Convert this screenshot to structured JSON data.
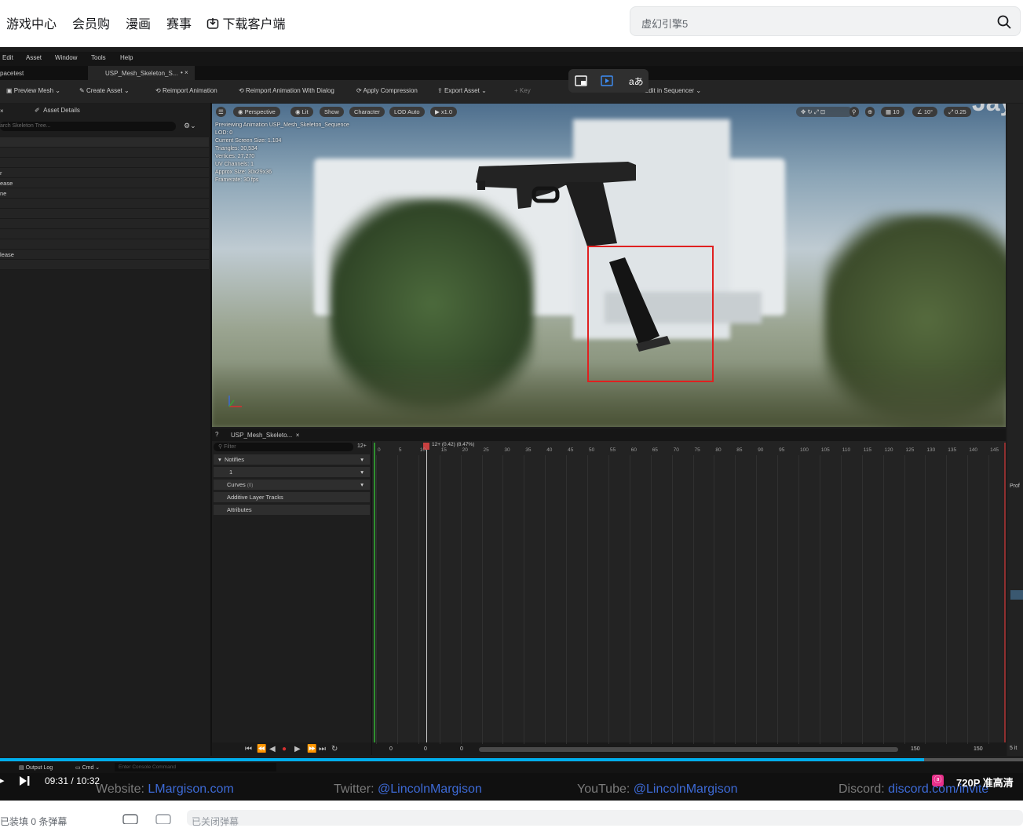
{
  "nav": {
    "items": [
      "游戏中心",
      "会员购",
      "漫画",
      "赛事"
    ],
    "download_label": "下载客户端",
    "search_value": "虚幻引擎5"
  },
  "ue": {
    "menu": [
      "Edit",
      "Asset",
      "Window",
      "Tools",
      "Help"
    ],
    "tabs": [
      "pacetest",
      "USP_Mesh_Skeleton_S..."
    ],
    "toolbar": [
      "Preview Mesh",
      "Create Asset",
      "Reimport Animation",
      "Reimport Animation With Dialog",
      "Apply Compression",
      "Export Asset",
      "Key",
      "Edit in Sequencer"
    ],
    "panel_title": "Asset Details",
    "search_placeholder": "arch Skeleton Tree...",
    "tree_labels": [
      "r",
      "ease",
      "ne",
      "lease"
    ],
    "viewport_pills": [
      "Perspective",
      "Lit",
      "Show",
      "Character",
      "LOD Auto",
      "x1.0"
    ],
    "viewport_right": [
      "10",
      "10°",
      "0.25"
    ],
    "stats": [
      "Previewing Animation USP_Mesh_Skeleton_Sequence",
      "LOD: 0",
      "Current Screen Size: 1.104",
      "Triangles: 30,534",
      "Vertices: 27,270",
      "UV Channels: 1",
      "Approx Size: 30x29x36",
      "Framerate: 30 fps"
    ],
    "watermark": "Jays",
    "sequencer_tab": "USP_Mesh_Skeleto...",
    "filter_placeholder": "Filter",
    "filter_count": "12+",
    "tracks": [
      "Notifies",
      "1",
      "Curves",
      "(0)",
      "Additive Layer Tracks",
      "Attributes"
    ],
    "playhead_label": "12+ (0.42) (8.47%)",
    "frame_ticks": [
      "0",
      "5",
      "10",
      "15",
      "20",
      "25",
      "30",
      "35",
      "40",
      "45",
      "50",
      "55",
      "60",
      "65",
      "70",
      "75",
      "80",
      "85",
      "90",
      "95",
      "100",
      "105",
      "110",
      "115",
      "120",
      "125",
      "130",
      "135",
      "140",
      "145"
    ],
    "range_labels": [
      "0",
      "0",
      "0",
      "150",
      "150"
    ],
    "bottom_tabs": [
      "Output Log",
      "Cmd",
      "Enter Console Command"
    ],
    "right_labels": [
      "Prof",
      "5 it"
    ]
  },
  "overlay_buttons": [
    "pip-icon",
    "auto-play-icon",
    "translate-icon"
  ],
  "translate_label": "aあ",
  "player": {
    "time_current": "09:31",
    "time_sep": "/",
    "time_total": "10:32",
    "quality": "720P 准高清",
    "progress": 0.903
  },
  "banner": [
    {
      "label": "Website:",
      "value": "LMargison.com"
    },
    {
      "label": "Twitter:",
      "value": "@LincolnMargison"
    },
    {
      "label": "YouTube:",
      "value": "@LincolnMargison"
    },
    {
      "label": "Discord:",
      "value": "discord.com/invite"
    }
  ],
  "bottom": {
    "status": "已装填 0 条弹幕",
    "danmaku_placeholder": "已关闭弹幕"
  }
}
